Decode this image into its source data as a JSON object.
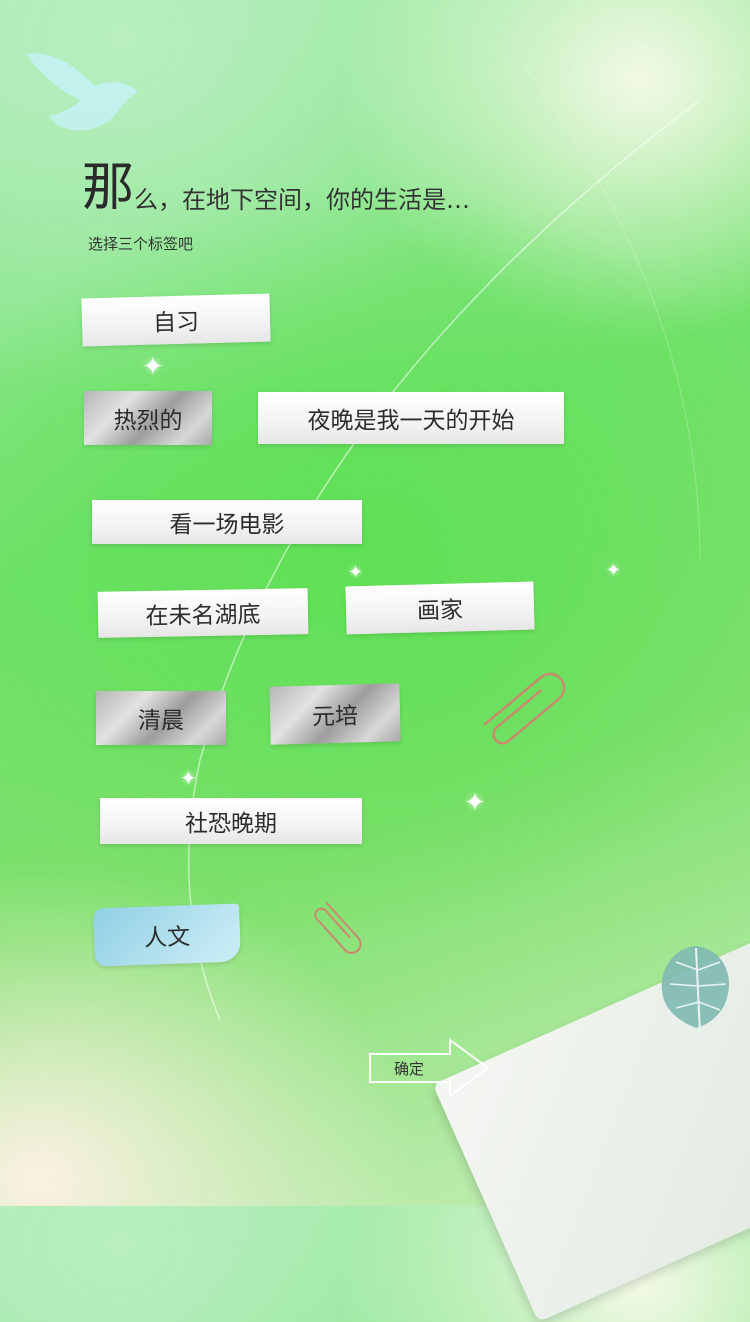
{
  "heading": {
    "big_char": "那",
    "rest": "么，在地下空间，你的生活是…",
    "subtitle": "选择三个标签吧"
  },
  "tags": [
    {
      "label": "自习",
      "style": "paper"
    },
    {
      "label": "热烈的",
      "style": "foil"
    },
    {
      "label": "夜晚是我一天的开始",
      "style": "paper"
    },
    {
      "label": "看一场电影",
      "style": "paper"
    },
    {
      "label": "在未名湖底",
      "style": "paper"
    },
    {
      "label": "画家",
      "style": "paper"
    },
    {
      "label": "清晨",
      "style": "foil"
    },
    {
      "label": "元培",
      "style": "foil"
    },
    {
      "label": "社恐晚期",
      "style": "paper"
    },
    {
      "label": "人文",
      "style": "blue"
    }
  ],
  "confirm_label": "确定",
  "icons": [
    "bird-icon",
    "sparkle-icon",
    "paperclip-icon",
    "leaf-icon",
    "arrow-right-icon"
  ],
  "colors": {
    "background_green": "#6fe168",
    "tag_paper": "#f3f3f3",
    "tag_foil": "#b5b5b5",
    "tag_blue": "#b6e2ef",
    "paperclip": "#c98a70"
  }
}
